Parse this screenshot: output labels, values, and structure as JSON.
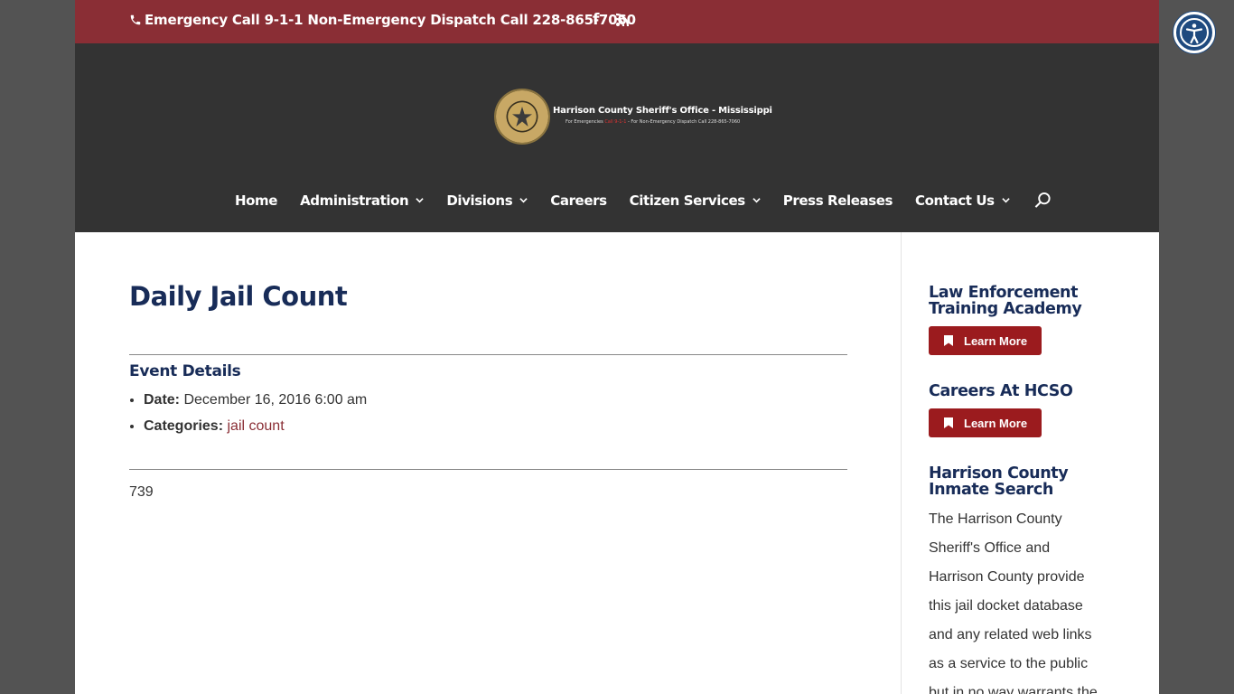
{
  "topbar": {
    "phone_text": "Emergency Call 9-1-1 Non-Emergency Dispatch Call 228-865-7060",
    "icons": [
      "phone-icon",
      "facebook-icon",
      "rss-icon"
    ]
  },
  "header": {
    "logo_title": "Harrison County Sheriff's Office - Mississippi",
    "logo_sub_prefix": "For Emergencies",
    "logo_sub_red": "Call 9-1-1",
    "logo_sub_suffix": " - For Non-Emergency Dispatch Call 228-865-7060"
  },
  "nav": {
    "items": [
      {
        "label": "Home",
        "dropdown": false
      },
      {
        "label": "Administration",
        "dropdown": true
      },
      {
        "label": "Divisions",
        "dropdown": true
      },
      {
        "label": "Careers",
        "dropdown": false
      },
      {
        "label": "Citizen Services",
        "dropdown": true
      },
      {
        "label": "Press Releases",
        "dropdown": false
      },
      {
        "label": "Contact Us",
        "dropdown": true
      }
    ]
  },
  "main": {
    "title": "Daily Jail Count",
    "event_details_title": "Event Details",
    "date_label": "Date:",
    "date_value": "December 16, 2016 6:00 am",
    "categories_label": "Categories:",
    "categories_value": "jail count",
    "count": "739"
  },
  "sidebar": {
    "widget1_title": "Law Enforcement Training Academy",
    "widget1_button": "Learn More",
    "widget2_title": "Careers At HCSO",
    "widget2_button": "Learn More",
    "widget3_title": "Harrison County Inmate Search",
    "widget3_text": "The Harrison County Sheriff's Office and Harrison County provide this jail docket database and any related web links as a service to the public but in no way warrants the"
  },
  "colors": {
    "topbar": "#8a2e35",
    "header": "#333333",
    "title": "#182c58",
    "button": "#9b1b1e",
    "link": "#8a2e35"
  }
}
